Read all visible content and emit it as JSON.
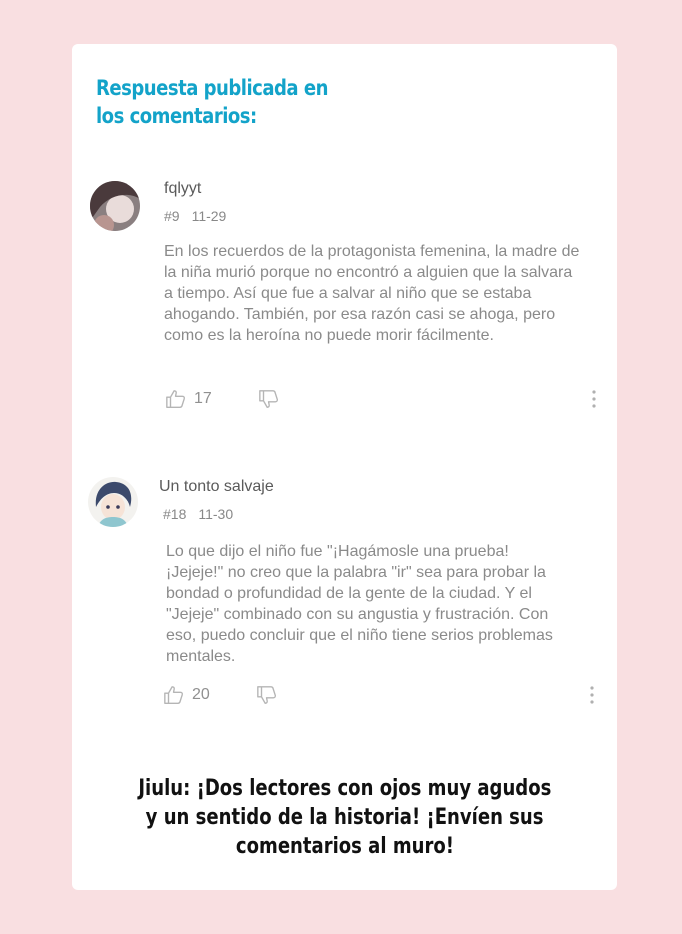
{
  "heading": {
    "line1": "Respuesta publicada en",
    "line2": "los comentarios:"
  },
  "comments": [
    {
      "username": "fqlyyt",
      "number": "#9",
      "date": "11-29",
      "text": "En los recuerdos de la protagonista femenina, la madre de la niña murió porque no encontró a alguien que la salvara a tiempo. Así que fue a salvar al niño que se estaba ahogando. También, por esa razón casi se ahoga, pero como es la heroína no puede morir fácilmente.",
      "likes": "17"
    },
    {
      "username": "Un tonto salvaje",
      "number": "#18",
      "date": "11-30",
      "text": "Lo que dijo el niño fue \"¡Hagámosle una prueba! ¡Jejeje!\" no creo que la palabra \"ir\" sea para probar la bondad o profundidad de la gente de la ciudad. Y el \"Jejeje\" combinado con su angustia y frustración. Con eso, puedo concluir que el niño tiene serios problemas mentales.",
      "likes": "20"
    }
  ],
  "footer": {
    "line1": "Jiulu: ¡Dos lectores con ojos muy agudos",
    "line2": "y un sentido de la historia! ¡Envíen sus",
    "line3": "comentarios al muro!"
  },
  "colors": {
    "background": "#f9dfe1",
    "heading": "#13a3c9"
  },
  "icons": [
    "thumbs-up-icon",
    "thumbs-down-icon",
    "more-vertical-icon"
  ]
}
